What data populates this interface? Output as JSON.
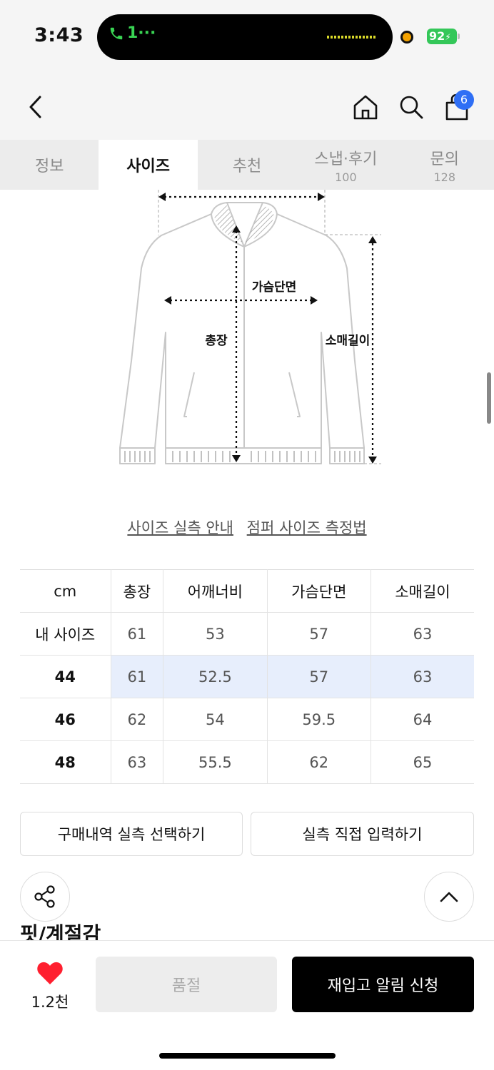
{
  "status_bar": {
    "time": "3:43",
    "call_label": "1···",
    "battery": "92"
  },
  "header": {
    "cart_count": "6"
  },
  "tabs": [
    {
      "label": "정보",
      "count": ""
    },
    {
      "label": "사이즈",
      "count": ""
    },
    {
      "label": "추천",
      "count": ""
    },
    {
      "label": "스냅·후기",
      "count": "100"
    },
    {
      "label": "문의",
      "count": "128"
    }
  ],
  "diagram": {
    "chest_label": "가슴단면",
    "length_label": "총장",
    "sleeve_label": "소매길이"
  },
  "links": {
    "size_guide": "사이즈 실측 안내",
    "measure_guide": "점퍼 사이즈 측정법"
  },
  "size_table": {
    "headers": [
      "cm",
      "총장",
      "어깨너비",
      "가슴단면",
      "소매길이"
    ],
    "rows": [
      [
        "내 사이즈",
        "61",
        "53",
        "57",
        "63"
      ],
      [
        "44",
        "61",
        "52.5",
        "57",
        "63"
      ],
      [
        "46",
        "62",
        "54",
        "59.5",
        "64"
      ],
      [
        "48",
        "63",
        "55.5",
        "62",
        "65"
      ]
    ]
  },
  "buttons": {
    "purchase_history": "구매내역 실측 선택하기",
    "direct_input": "실측 직접 입력하기"
  },
  "section": {
    "title": "핏/계절감"
  },
  "bottom_bar": {
    "like_count": "1.2천",
    "soldout": "품절",
    "restock": "재입고 알림 신청"
  },
  "colors": {
    "accent_blue": "#2f6ff5",
    "highlight_row": "#e7eefc",
    "like_red": "#ff1f2f",
    "battery_green": "#34c759"
  }
}
